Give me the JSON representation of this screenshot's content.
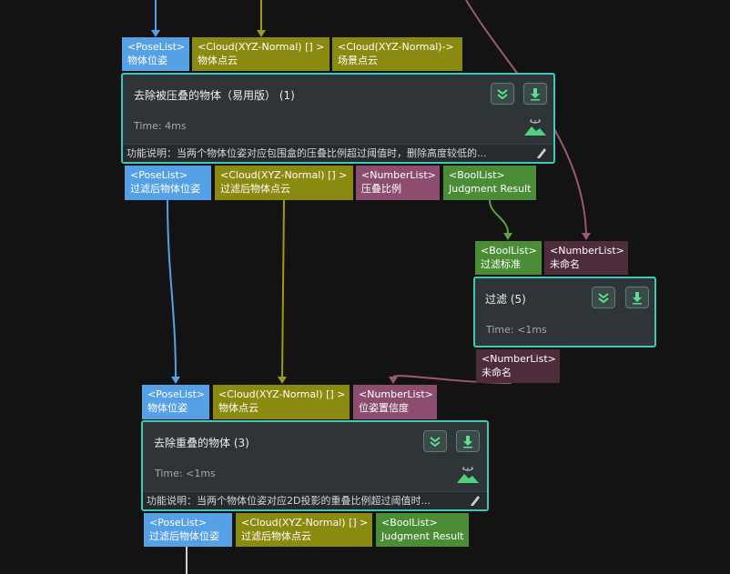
{
  "colors": {
    "background": "#131313",
    "node_border": "#3fc9b6",
    "pose_port": "#56a0e6",
    "cloud_port": "#8a8a10",
    "number_port": "#8d4d6f",
    "bool_port": "#4b8c37"
  },
  "node1": {
    "inputs": [
      {
        "type": "<PoseList>",
        "name": "物体位姿"
      },
      {
        "type": "<Cloud(XYZ-Normal) [] >",
        "name": "物体点云"
      },
      {
        "type": "<Cloud(XYZ-Normal)->",
        "name": "场景点云"
      }
    ],
    "title": "去除被压叠的物体（易用版） (1)",
    "time": "Time: 4ms",
    "desc": "功能说明：当两个物体位姿对应包围盒的压叠比例超过阈值时，删除高度较低的...",
    "outputs": [
      {
        "type": "<PoseList>",
        "name": "过滤后物体位姿"
      },
      {
        "type": "<Cloud(XYZ-Normal) [] >",
        "name": "过滤后物体点云"
      },
      {
        "type": "<NumberList>",
        "name": "压叠比例"
      },
      {
        "type": "<BoolList>",
        "name": "Judgment Result"
      }
    ],
    "icons": [
      "collapse-icon",
      "download-icon",
      "mountain-icon",
      "pen-icon"
    ]
  },
  "node2": {
    "inputs": [
      {
        "type": "<BoolList>",
        "name": "过滤标准"
      },
      {
        "type": "<NumberList>",
        "name": "未命名"
      }
    ],
    "title": "过滤 (5)",
    "time": "Time: <1ms",
    "outputs": [
      {
        "type": "<NumberList>",
        "name": "未命名"
      }
    ]
  },
  "node3": {
    "inputs": [
      {
        "type": "<PoseList>",
        "name": "物体位姿"
      },
      {
        "type": "<Cloud(XYZ-Normal) [] >",
        "name": "物体点云"
      },
      {
        "type": "<NumberList>",
        "name": "位姿置信度"
      }
    ],
    "title": "去除重叠的物体 (3)",
    "time": "Time: <1ms",
    "desc": "功能说明：当两个物体位姿对应2D投影的重叠比例超过阈值时...",
    "outputs": [
      {
        "type": "<PoseList>",
        "name": "过滤后物体位姿"
      },
      {
        "type": "<Cloud(XYZ-Normal) [] >",
        "name": "过滤后物体点云"
      },
      {
        "type": "<BoolList>",
        "name": "Judgment Result"
      }
    ]
  }
}
